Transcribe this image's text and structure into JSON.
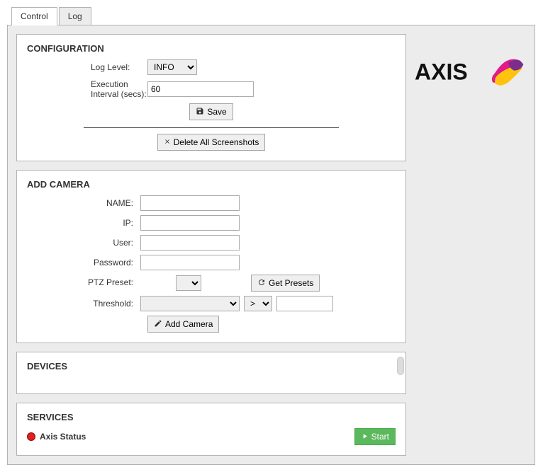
{
  "tabs": {
    "control": "Control",
    "log": "Log"
  },
  "brand": "AXIS",
  "config": {
    "title": "CONFIGURATION",
    "log_level_label": "Log Level:",
    "log_level_value": "INFO",
    "interval_label": "Execution Interval (secs):",
    "interval_value": "60",
    "save_button": "Save",
    "delete_button": "Delete All Screenshots"
  },
  "addcam": {
    "title": "ADD CAMERA",
    "name_label": "NAME:",
    "ip_label": "IP:",
    "user_label": "User:",
    "password_label": "Password:",
    "ptz_label": "PTZ Preset:",
    "get_presets": "Get Presets",
    "threshold_label": "Threshold:",
    "op_value": ">",
    "add_button": "Add Camera"
  },
  "devices": {
    "title": "DEVICES"
  },
  "services": {
    "title": "SERVICES",
    "status_label": "Axis Status",
    "start_button": "Start"
  }
}
